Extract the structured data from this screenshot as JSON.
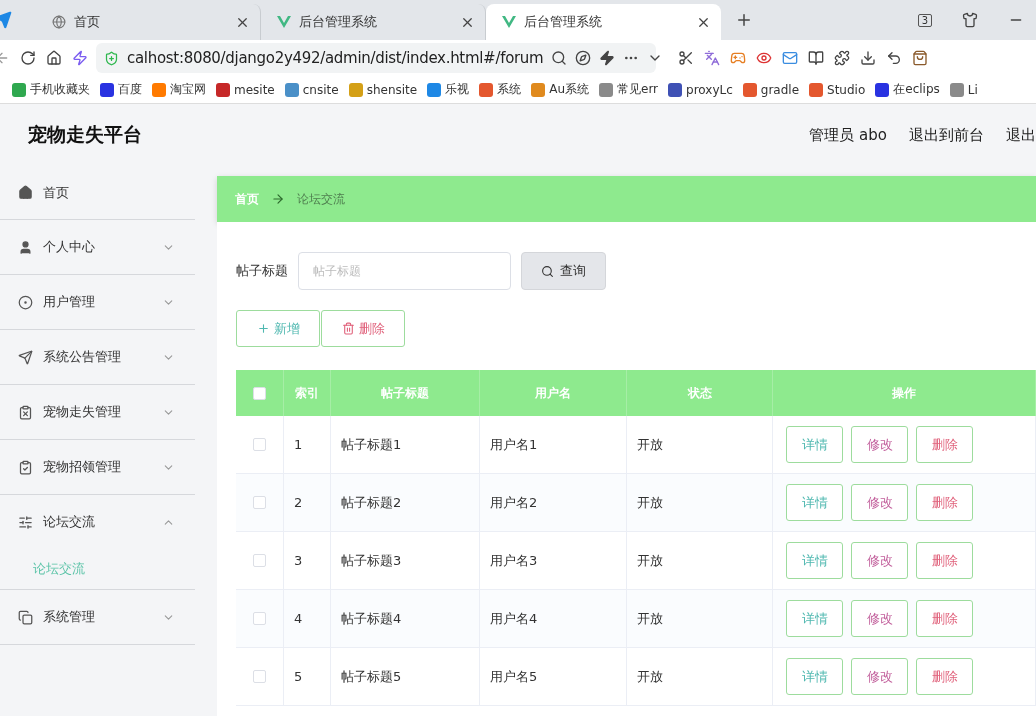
{
  "browser": {
    "tabs": [
      {
        "title": "首页",
        "kind": "globe",
        "selected": false
      },
      {
        "title": "后台管理系统",
        "kind": "vue",
        "selected": false
      },
      {
        "title": "后台管理系统",
        "kind": "vue",
        "selected": true
      }
    ],
    "tab_count": "3",
    "address": "calhost:8080/django2y492/admin/dist/index.html#/forum",
    "bookmarks": [
      {
        "label": "手机收藏夹",
        "color": "#2fa84f"
      },
      {
        "label": "百度",
        "color": "#2932e1"
      },
      {
        "label": "淘宝网",
        "color": "#ff7a00"
      },
      {
        "label": "mesite",
        "color": "#c62828"
      },
      {
        "label": "cnsite",
        "color": "#4a90c8"
      },
      {
        "label": "shensite",
        "color": "#d4a017"
      },
      {
        "label": "乐视",
        "color": "#1e88e5"
      },
      {
        "label": "系统",
        "color": "#e4572e"
      },
      {
        "label": "Au系统",
        "color": "#e08a1e"
      },
      {
        "label": "常见err",
        "color": "#8a8a8a"
      },
      {
        "label": "proxyLc",
        "color": "#3f51b5"
      },
      {
        "label": "gradle",
        "color": "#e4572e"
      },
      {
        "label": "Studio",
        "color": "#e4572e"
      },
      {
        "label": "在eclips",
        "color": "#2932e1"
      },
      {
        "label": "Li",
        "color": "#8a8a8a"
      }
    ]
  },
  "header": {
    "title": "宠物走失平台",
    "user": "管理员 abo",
    "links": [
      "退出到前台",
      "退出"
    ]
  },
  "sidebar": {
    "items": [
      {
        "label": "首页",
        "kind": "link"
      },
      {
        "label": "个人中心",
        "kind": "group",
        "expanded": false
      },
      {
        "label": "用户管理",
        "kind": "group",
        "expanded": false
      },
      {
        "label": "系统公告管理",
        "kind": "group",
        "expanded": false
      },
      {
        "label": "宠物走失管理",
        "kind": "group",
        "expanded": false
      },
      {
        "label": "宠物招领管理",
        "kind": "group",
        "expanded": false
      },
      {
        "label": "论坛交流",
        "kind": "group",
        "expanded": true,
        "children": [
          {
            "label": "论坛交流",
            "selected": true
          }
        ]
      },
      {
        "label": "系统管理",
        "kind": "group",
        "expanded": false
      }
    ]
  },
  "breadcrumb": [
    "首页",
    "论坛交流"
  ],
  "search": {
    "label": "帖子标题",
    "placeholder": "帖子标题",
    "button": "查询"
  },
  "actions": [
    "新增",
    "删除"
  ],
  "table": {
    "columns": [
      "索引",
      "帖子标题",
      "用户名",
      "状态",
      "操作"
    ],
    "header_checked": false,
    "rows": [
      {
        "checked": false,
        "cells": [
          "1",
          "帖子标题1",
          "用户名1",
          "开放"
        ],
        "buttons": [
          "详情",
          "修改",
          "删除"
        ]
      },
      {
        "checked": false,
        "cells": [
          "2",
          "帖子标题2",
          "用户名2",
          "开放"
        ],
        "buttons": [
          "详情",
          "修改",
          "删除"
        ]
      },
      {
        "checked": false,
        "cells": [
          "3",
          "帖子标题3",
          "用户名3",
          "开放"
        ],
        "buttons": [
          "详情",
          "修改",
          "删除"
        ]
      },
      {
        "checked": false,
        "cells": [
          "4",
          "帖子标题4",
          "用户名4",
          "开放"
        ],
        "buttons": [
          "详情",
          "修改",
          "删除"
        ]
      },
      {
        "checked": false,
        "cells": [
          "5",
          "帖子标题5",
          "用户名5",
          "开放"
        ],
        "buttons": [
          "详情",
          "修改",
          "删除"
        ]
      }
    ]
  }
}
